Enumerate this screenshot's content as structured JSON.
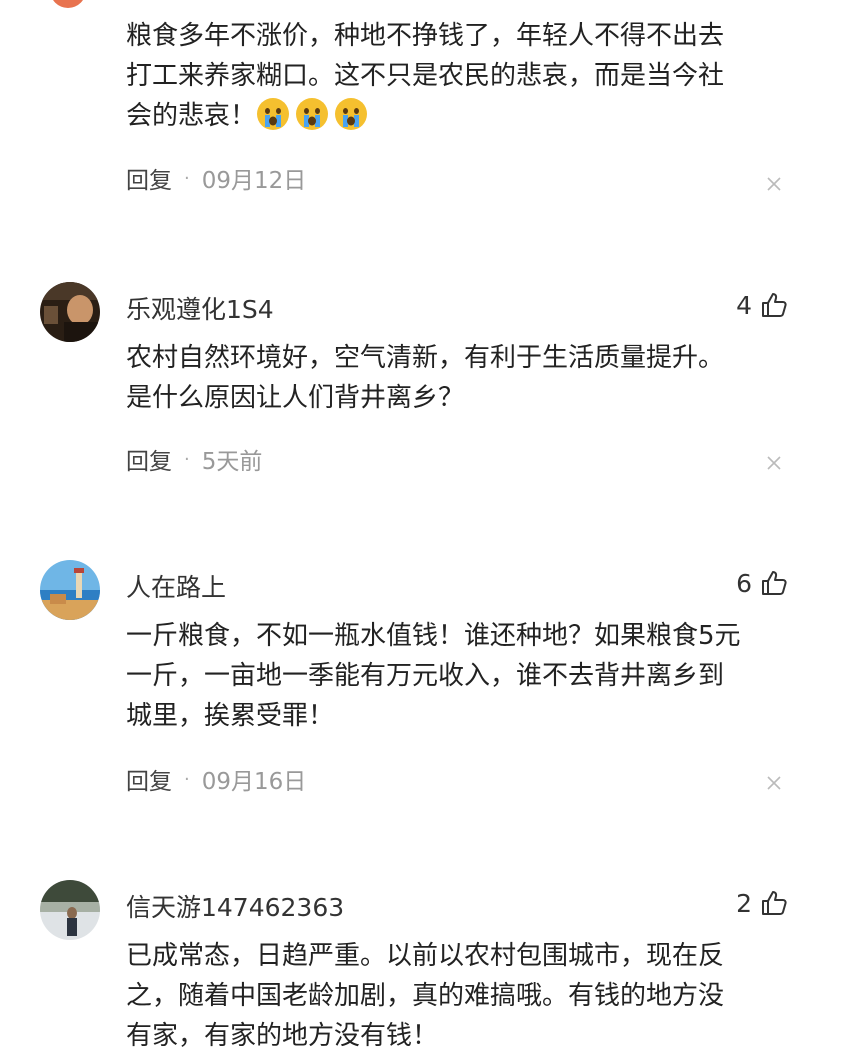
{
  "comments": [
    {
      "username": "",
      "likes": "",
      "text_lines": [
        "粮食多年不涨价，种地不挣钱了，年轻人不得不出去",
        "打工来养家糊口。这不只是农民的悲哀，而是当今社",
        "会的悲哀！"
      ],
      "emoji": [
        "crying-face",
        "crying-face",
        "crying-face"
      ],
      "reply_label": "回复",
      "time": "09月12日"
    },
    {
      "username": "乐观遵化1S4",
      "likes": "4",
      "text_lines": [
        "农村自然环境好，空气清新，有利于生活质量提升。",
        "是什么原因让人们背井离乡？"
      ],
      "reply_label": "回复",
      "time": "5天前"
    },
    {
      "username": "人在路上",
      "likes": "6",
      "text_lines": [
        "一斤粮食，不如一瓶水值钱！谁还种地？如果粮食5元",
        "一斤，一亩地一季能有万元收入，谁不去背井离乡到",
        "城里，挨累受罪！"
      ],
      "reply_label": "回复",
      "time": "09月16日"
    },
    {
      "username": "信天游147462363",
      "likes": "2",
      "text_lines": [
        "已成常态，日趋严重。以前以农村包围城市，现在反",
        "之，随着中国老龄加剧，真的难搞哦。有钱的地方没",
        "有家，有家的地方没有钱！"
      ]
    }
  ],
  "colors": {
    "text": "#222222",
    "username": "#333333",
    "meta": "#999999",
    "emoji_face": "#f5c02f",
    "emoji_tear": "#4aa3f0"
  }
}
